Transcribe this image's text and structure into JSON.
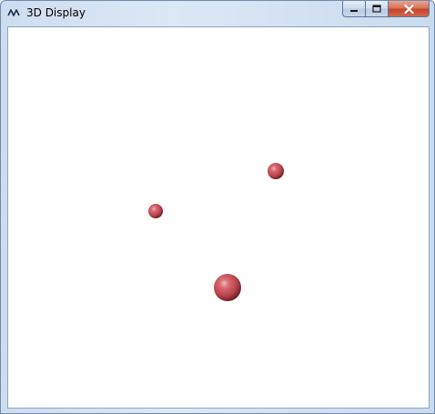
{
  "window": {
    "title": "3D Display",
    "app_icon": "wave-logo-icon",
    "buttons": {
      "minimize_icon": "minimize-icon",
      "maximize_icon": "maximize-icon",
      "close_icon": "close-icon"
    },
    "colors": {
      "close_button": "#c4432b",
      "background": "#ffffff",
      "sphere": "#c24a52"
    }
  },
  "scene": {
    "objects": [
      {
        "name": "sphere-1"
      },
      {
        "name": "sphere-2"
      },
      {
        "name": "sphere-3"
      }
    ]
  }
}
